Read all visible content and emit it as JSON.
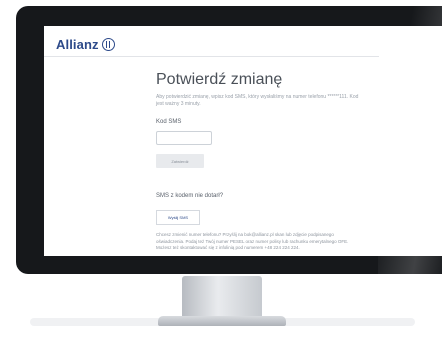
{
  "brand": {
    "name": "Allianz"
  },
  "page": {
    "title": "Potwierdź zmianę",
    "intro": "Aby potwierdzić zmianę, wpisz kod SMS, który wysłaliśmy na numer telefonu ******111. Kod jest ważny 3 minuty.",
    "code_label": "Kod SMS",
    "code_value": "",
    "confirm_label": "Zatwierdź",
    "sms_question": "SMS z kodem nie dotarł?",
    "resend_label": "Wyślij SMS",
    "footer_note": "Chcesz zmienić numer telefonu? Przyślij na bok@allianz.pl skan lub zdjęcie podpisanego oświadczenia. Podaj też Twój numer PESEL oraz numer polisy lub rachunku emerytalnego OFE. Możesz też skontaktować się z infolinią pod numerem +48 224 224 224."
  },
  "colors": {
    "brand": "#2d4a8a",
    "bezel": "#16181b",
    "title": "#4a5058",
    "muted_text": "#9aa1aa"
  }
}
